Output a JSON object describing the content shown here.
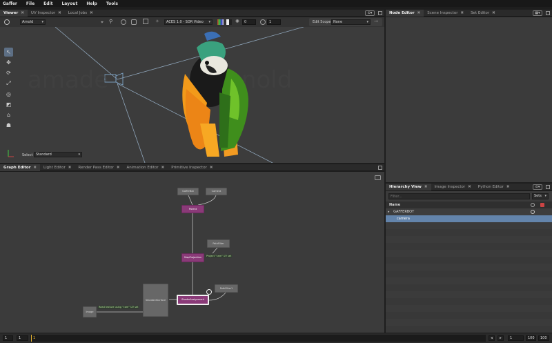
{
  "menu": [
    "Gaffer",
    "File",
    "Edit",
    "Layout",
    "Help",
    "Tools"
  ],
  "viewer_tabs": [
    {
      "label": "Viewer",
      "active": true
    },
    {
      "label": "UV Inspector",
      "active": false
    },
    {
      "label": "Local Jobs",
      "active": false
    }
  ],
  "viewer_toolbar": {
    "renderer": "Arnold",
    "display_transform": "ACES 1.0 - SDR Video",
    "exposure": "0",
    "gamma": "1",
    "edit_scope_label": "Edit Scope",
    "edit_scope_value": "None"
  },
  "viewport": {
    "select_label": "Select",
    "select_value": "Standard"
  },
  "graph_tabs": [
    {
      "label": "Graph Editor",
      "active": true
    },
    {
      "label": "Light Editor",
      "active": false
    },
    {
      "label": "Render Pass Editor",
      "active": false
    },
    {
      "label": "Animation Editor",
      "active": false
    },
    {
      "label": "Primitive Inspector",
      "active": false
    }
  ],
  "graph_nodes": {
    "gafferbot": "GafferBot",
    "camera": "Camera",
    "parent": "Parent",
    "pathfilter1": "PathFilter",
    "mapprojection": "MapProjection",
    "mapprojection_label": "Project \"cam\" UV set",
    "pathfilter2": "PathFilter1",
    "standardsurface": "StandardSurface",
    "shaderassignment": "ShaderAssignment",
    "image": "Image",
    "image_label": "Read texture using \"cam\" UV set"
  },
  "right_top_tabs": [
    {
      "label": "Node Editor",
      "active": true
    },
    {
      "label": "Scene Inspector",
      "active": false
    },
    {
      "label": "Set Editor",
      "active": false
    }
  ],
  "right_bottom_tabs": [
    {
      "label": "Hierarchy View",
      "active": true
    },
    {
      "label": "Image Inspector",
      "active": false
    },
    {
      "label": "Python Editor",
      "active": false
    }
  ],
  "hierarchy": {
    "filter_placeholder": "Filter...",
    "sets_label": "Sets",
    "column_name": "Name",
    "rows": [
      {
        "label": "GAFFERBOT",
        "expanded": false,
        "indent": 0
      },
      {
        "label": "camera",
        "expanded": false,
        "indent": 1,
        "selected": true
      }
    ]
  },
  "timeline": {
    "start": "1",
    "current": "1",
    "frame_marker": "1",
    "end": "100",
    "range_end": "100",
    "range_start": "1"
  },
  "colors": {
    "accent": "#5a7ca3",
    "node_purple": "#8a3a78",
    "selection": "#6384ab"
  }
}
